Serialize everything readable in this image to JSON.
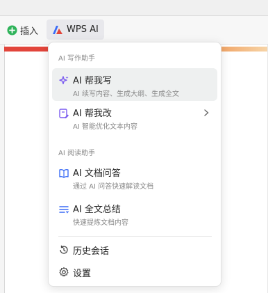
{
  "toolbar": {
    "insert_label": "插入",
    "wps_ai_label": "WPS AI"
  },
  "menu": {
    "section_write": "AI 写作助手",
    "section_read": "AI 阅读助手",
    "items": [
      {
        "label": "AI 帮我写",
        "sub": "AI 续写内容、生成大纲、生成全文",
        "icon": "sparkle-icon"
      },
      {
        "label": "AI 帮我改",
        "sub": "AI 智能优化文本内容",
        "icon": "edit-doc-icon"
      },
      {
        "label": "AI 文档问答",
        "sub": "通过 AI 问答快速解读文档",
        "icon": "book-qa-icon"
      },
      {
        "label": "AI 全文总结",
        "sub": "快速提炼文档内容",
        "icon": "summary-list-icon"
      }
    ],
    "history_label": "历史会话",
    "settings_label": "设置"
  },
  "colors": {
    "accent_purple": "#7b5cf0",
    "insert_green": "#2fb35a",
    "banner_red": "#e2453b"
  }
}
